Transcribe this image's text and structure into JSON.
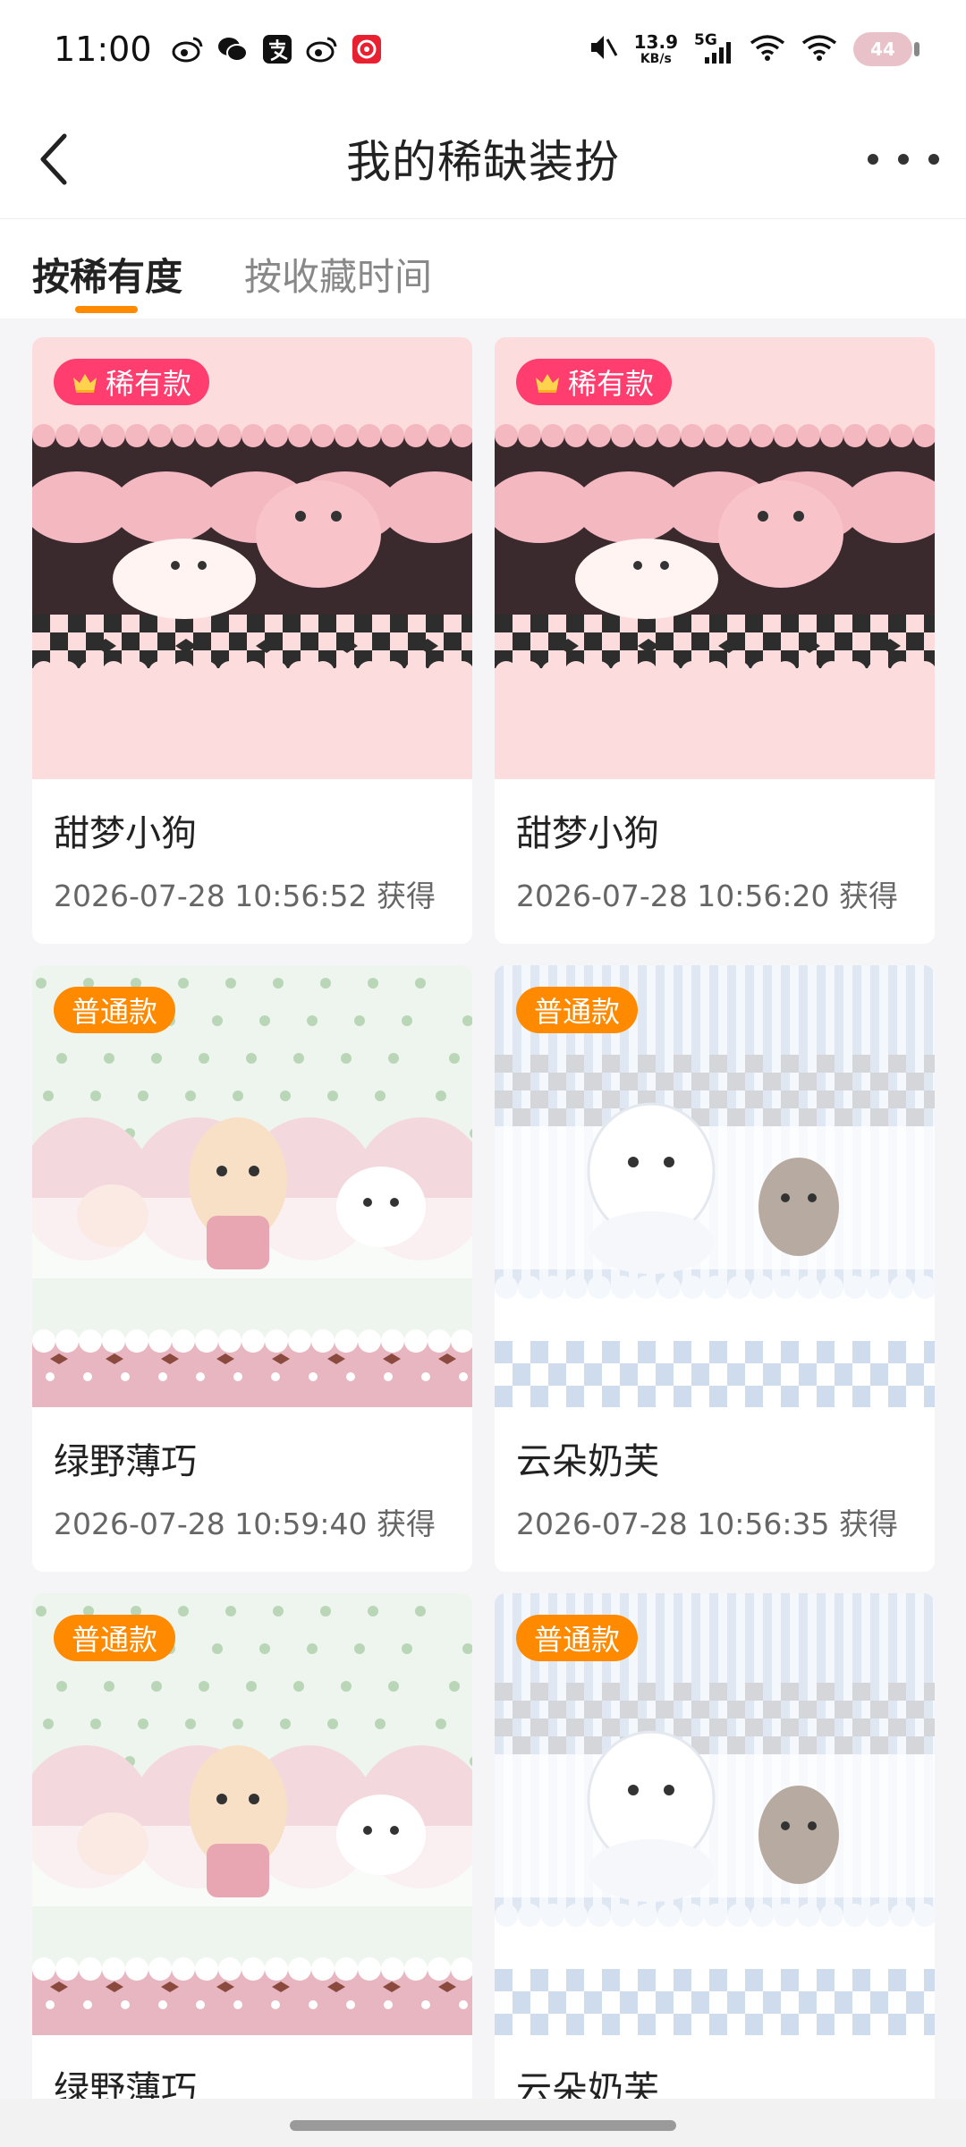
{
  "status_bar": {
    "time": "11:00",
    "app_icons": [
      "weibo-icon",
      "wechat-icon",
      "alipay-icon",
      "weibo-icon",
      "game-icon"
    ],
    "net_speed_value": "13.9",
    "net_speed_unit": "KB/s",
    "network": "5G",
    "battery": "44"
  },
  "header": {
    "title": "我的稀缺装扮",
    "back_icon": "chevron-left-icon",
    "more_icon": "more-horizontal-icon"
  },
  "tabs": [
    {
      "label": "按稀有度",
      "active": true
    },
    {
      "label": "按收藏时间",
      "active": false
    }
  ],
  "colors": {
    "accent": "#ff8a00",
    "rare_badge": "#ff3d6e",
    "common_badge": "#ff8a00"
  },
  "cards": [
    {
      "badge": "稀有款",
      "rarity": "rare",
      "name": "甜梦小狗",
      "date": "2026-07-28 10:56:52 获得",
      "theme": "pink-dog"
    },
    {
      "badge": "稀有款",
      "rarity": "rare",
      "name": "甜梦小狗",
      "date": "2026-07-28 10:56:20 获得",
      "theme": "pink-dog"
    },
    {
      "badge": "普通款",
      "rarity": "common",
      "name": "绿野薄巧",
      "date": "2026-07-28 10:59:40 获得",
      "theme": "green-mint"
    },
    {
      "badge": "普通款",
      "rarity": "common",
      "name": "云朵奶芙",
      "date": "2026-07-28 10:56:35 获得",
      "theme": "blue-cloud"
    },
    {
      "badge": "普通款",
      "rarity": "common",
      "name": "绿野薄巧",
      "date": "",
      "theme": "green-mint"
    },
    {
      "badge": "普通款",
      "rarity": "common",
      "name": "云朵奶芙",
      "date": "",
      "theme": "blue-cloud"
    }
  ]
}
